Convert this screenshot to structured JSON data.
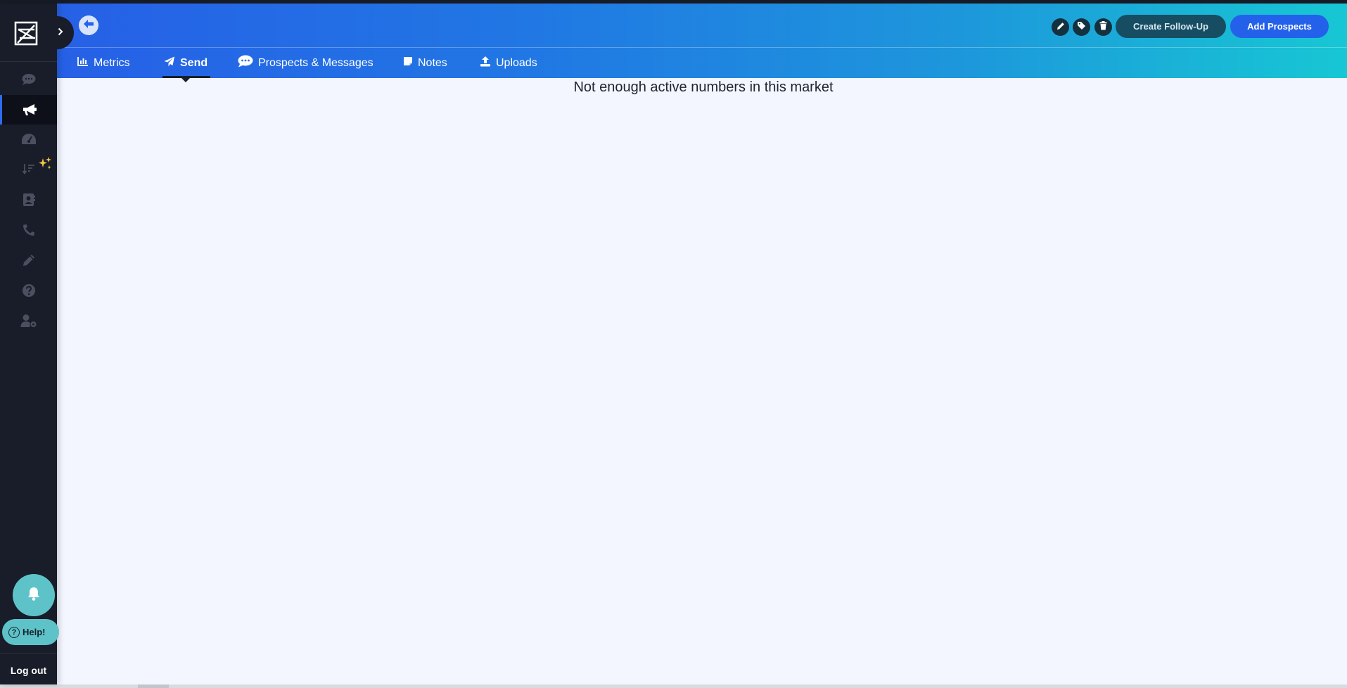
{
  "sidebar": {
    "logo_icon": "brand-logo-icon",
    "expand_icon": "chevron-right-icon",
    "items": [
      {
        "name": "messages",
        "icon": "chat-bubble-icon",
        "active": false
      },
      {
        "name": "campaigns",
        "icon": "megaphone-icon",
        "active": true
      },
      {
        "name": "dashboard",
        "icon": "speedometer-icon",
        "active": false
      },
      {
        "name": "sort",
        "icon": "sort-sparkle-icon",
        "active": false
      },
      {
        "name": "contacts",
        "icon": "contact-book-icon",
        "active": false
      },
      {
        "name": "calls",
        "icon": "phone-icon",
        "active": false
      },
      {
        "name": "templates",
        "icon": "pencil-icon",
        "active": false
      },
      {
        "name": "help-center",
        "icon": "question-icon",
        "active": false
      },
      {
        "name": "user-settings",
        "icon": "user-gear-icon",
        "active": false
      }
    ],
    "help_label": "Help!",
    "logout_label": "Log out"
  },
  "header": {
    "back_icon": "arrow-left-circle-icon",
    "action_icons": [
      "pencil-icon",
      "tags-icon",
      "trash-icon"
    ],
    "create_follow_up_label": "Create Follow-Up",
    "add_prospects_label": "Add Prospects",
    "tabs": [
      {
        "label": "Metrics",
        "icon": "bar-chart-icon",
        "active": false
      },
      {
        "label": "Send",
        "icon": "paper-plane-icon",
        "active": true
      },
      {
        "label": "Prospects & Messages",
        "icon": "comments-icon",
        "active": false
      },
      {
        "label": "Notes",
        "icon": "sticky-note-icon",
        "active": false
      },
      {
        "label": "Uploads",
        "icon": "upload-icon",
        "active": false
      }
    ]
  },
  "main": {
    "empty_message": "Not enough active numbers in this market"
  },
  "colors": {
    "sidebar_bg": "#181d29",
    "header_gradient_start": "#2660e6",
    "header_gradient_end": "#17c7d4",
    "accent_blue": "#2461ea",
    "teal": "#5ec3c9",
    "page_bg": "#f3f6fe"
  }
}
